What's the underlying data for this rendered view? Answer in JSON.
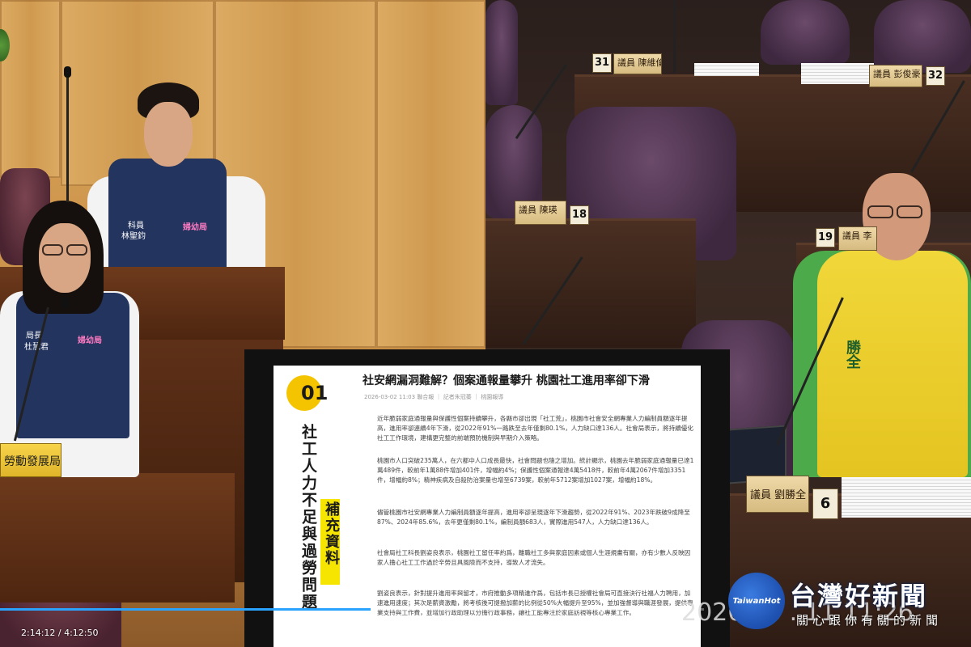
{
  "left_scene": {
    "standing_person": {
      "title": "科員",
      "name": "林聖鈞",
      "vest_logo": "婦幼局"
    },
    "seated_person": {
      "title": "局長",
      "name": "杜慧君",
      "vest_logo": "婦幼局"
    },
    "nameplate": "勞動發展局長"
  },
  "right_scene": {
    "seats": [
      {
        "num": "31",
        "plate": "議員 陳維倫"
      },
      {
        "num": "32",
        "plate": "議員 彭俊豪"
      },
      {
        "num": "18",
        "plate": "議員 陳瑛"
      },
      {
        "num": "19",
        "plate": "議員 李"
      },
      {
        "num": "6",
        "plate": "議員 劉勝全"
      }
    ],
    "speaker_vest_name": "勝全"
  },
  "news_card": {
    "section_number": "01",
    "vertical_title": "社工人力不足與過勞問題",
    "vertical_subtitle": "補充資料",
    "headline": "社安網漏洞難解？個案通報量攀升 桃園社工進用率卻下滑",
    "meta": "2026-03-02 11:03  聯合報 ｜ 記者朱冠蓁 ｜ 桃園報導",
    "paragraphs": [
      "近年脆弱家庭通報量與保護性個案持續攀升，各縣市卻出現「社工荒」，桃園市社會安全網專業人力編制員額逐年提高，進用率卻連續4年下滑，從2022年91%一路跌至去年僅剩80.1%，人力缺口達136人。社會局表示，將持續優化社工工作環境，建構更完整的前端預防機制與早期介入策略。",
      "桃園市人口突破235萬人，在六都中人口成長最快，社會問題也隨之增加。統計顯示，桃園去年脆弱家庭通報量已達1萬489件，較前年1萬88件增加401件，增幅約4%；保護性個案通報達4萬5418件，較前年4萬2067件增加3351件，增幅約8%；精神疾病及自殺防治案量也增至6739案，較前年5712案增加1027案，增幅約18%。",
      "儘管桃園市社安網專業人力編制員額逐年提高，進用率卻呈現逐年下滑趨勢，從2022年91%、2023年跌破9成降至87%、2024年85.6%，去年更僅剩80.1%，編制員額683人，實際進用547人，人力缺口達136人。",
      "社會局社工科長劉姿良表示，桃園社工留任率約爲，離職社工多與家庭因素或個人生涯規畫有關，亦有少數人反映因家人擔心社工工作過於辛勞且具風險而不支持，導致人才流失。",
      "劉姿良表示，針對提升進用率與留才，市府推動多項精進作爲，包括市長已授權社會局可直接決行社福人力聘用，加速進用速度；其次是薪資激勵，將考核後可提撥加薪的比例從50%大幅提升至95%，並加強督導與職涯發展，提供專業支持與工作費，並增加行政助理以分擔行政事務，讓社工能專注於家庭訪視等核心專業工作。"
    ]
  },
  "player": {
    "timestamp": "2:14:12 / 4:12:50",
    "progress": 0.5266,
    "date_overlay": "2026 . 3 . 11  11:26"
  },
  "brand": {
    "circle_text": "TaiwanHot",
    "name": "台灣好新聞",
    "slogan": "關心跟你有關的新聞",
    "color": "#1d4fae"
  }
}
